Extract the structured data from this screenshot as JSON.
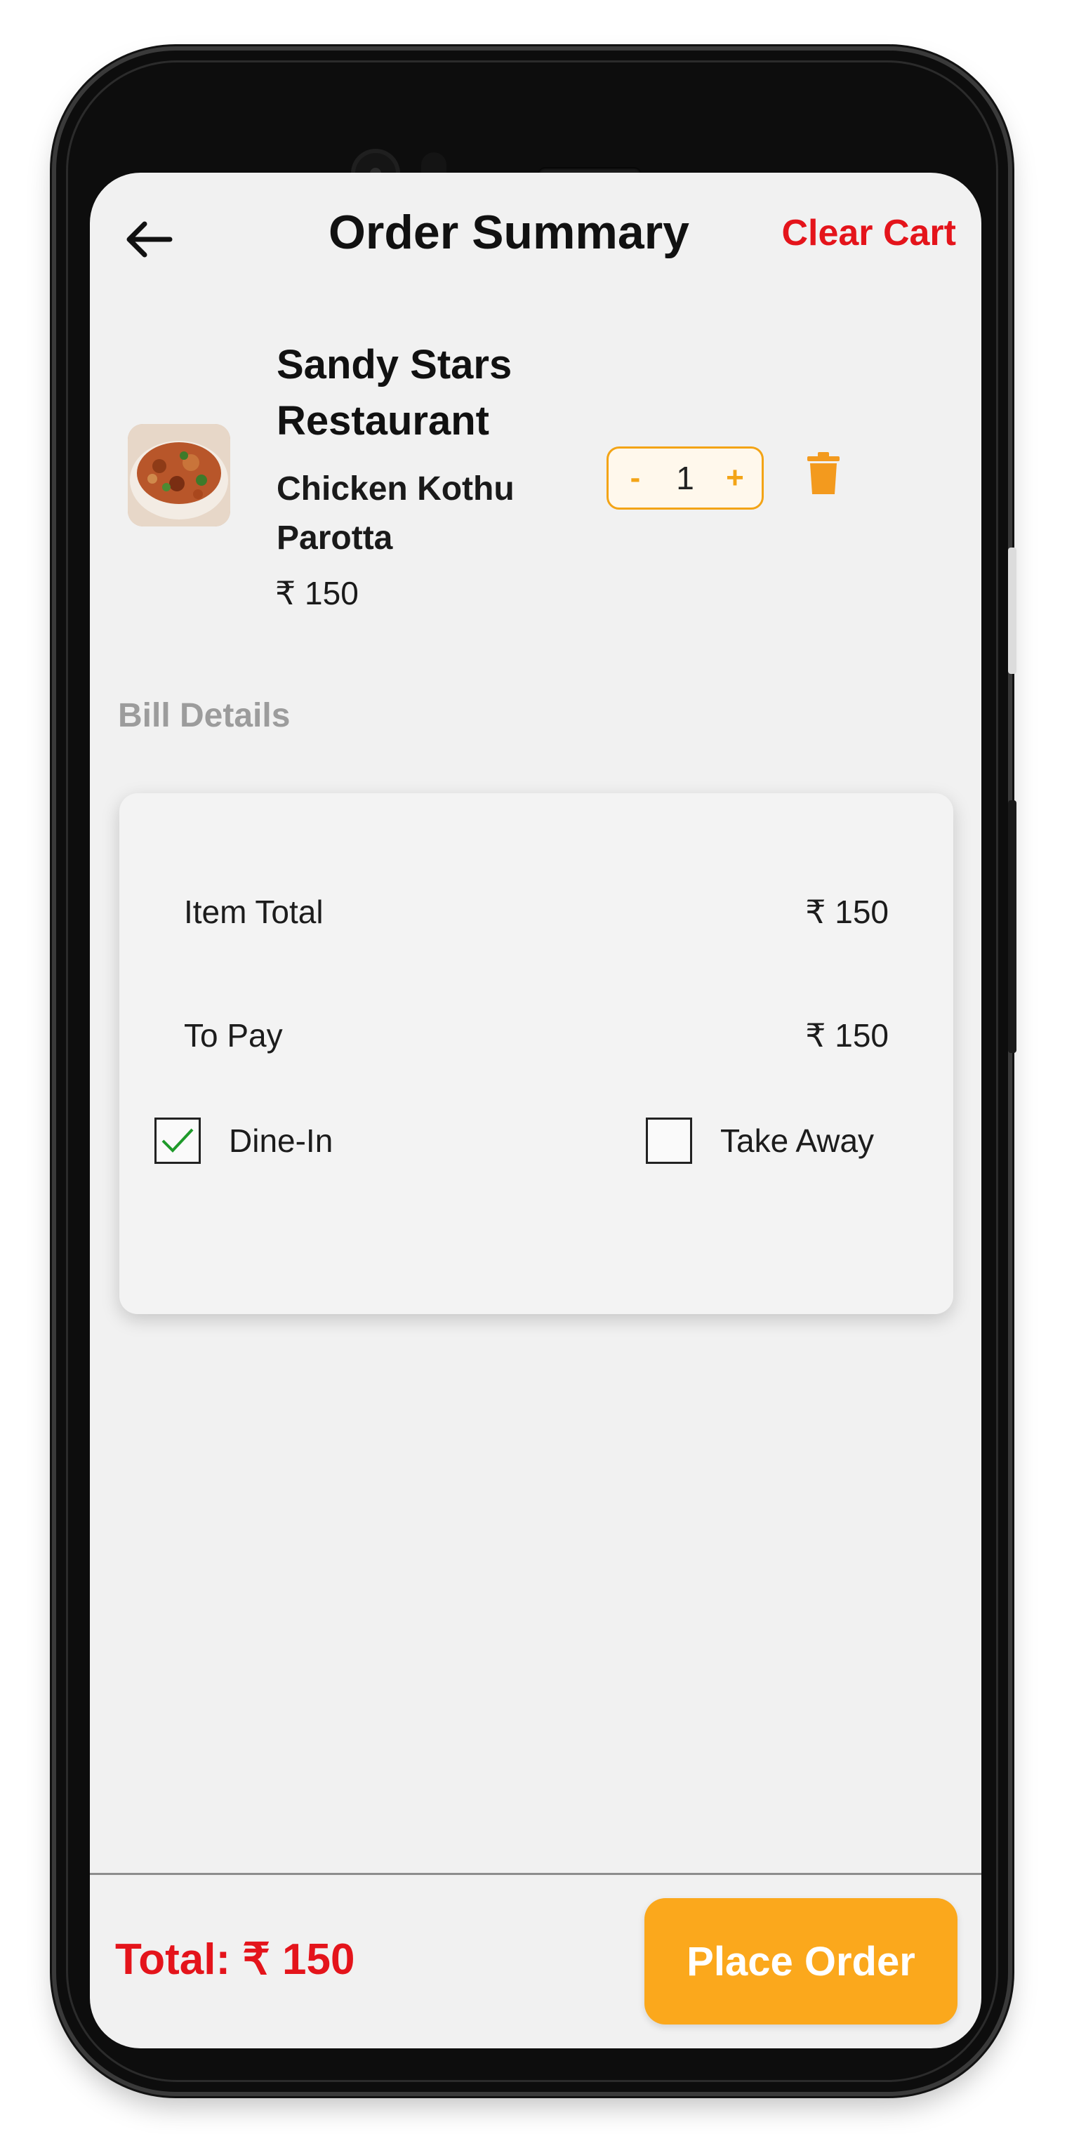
{
  "header": {
    "title": "Order Summary",
    "clear_cart_label": "Clear Cart"
  },
  "cart_item": {
    "restaurant": "Sandy Stars Restaurant",
    "dish": "Chicken Kothu Parotta",
    "price": "₹ 150",
    "quantity": "1",
    "decrement_label": "-",
    "increment_label": "+",
    "thumbnail_icon": "food-thumbnail",
    "delete_icon": "trash-icon"
  },
  "bill": {
    "heading": "Bill Details",
    "rows": [
      {
        "label": "Item Total",
        "value": "₹ 150"
      },
      {
        "label": "To Pay",
        "value": "₹ 150"
      }
    ],
    "options": [
      {
        "label": "Dine-In",
        "checked": true
      },
      {
        "label": "Take Away",
        "checked": false
      }
    ]
  },
  "footer": {
    "total_text": "Total: ₹ 150",
    "place_order_label": "Place Order"
  },
  "colors": {
    "accent": "#fba81c",
    "danger": "#e4141b",
    "checkmark": "#1e9a2a",
    "background": "#f1f1f1"
  }
}
